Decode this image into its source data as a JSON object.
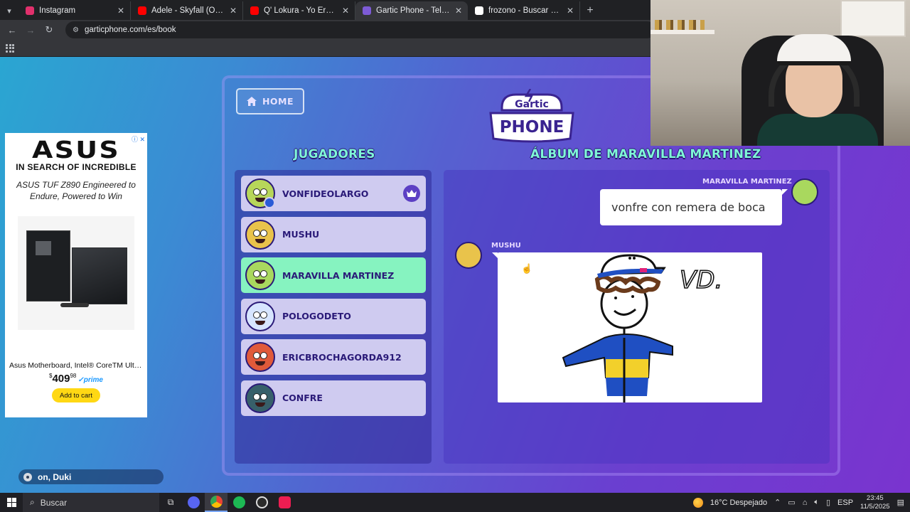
{
  "browser": {
    "tabs": [
      {
        "title": "Instagram",
        "favicon_color": "#e1306c",
        "active": false
      },
      {
        "title": "Adele - Skyfall (Official Lyric Vid",
        "favicon_color": "#ff0000",
        "active": false
      },
      {
        "title": "Q' Lokura - Yo Era (Video Clip C",
        "favicon_color": "#ff0000",
        "active": false
      },
      {
        "title": "Gartic Phone - Teléfono Descon",
        "favicon_color": "#7d5bd6",
        "active": true
      },
      {
        "title": "frozono - Buscar con Google",
        "favicon_color": "#ffffff",
        "active": false
      }
    ],
    "url": "garticphone.com/es/book"
  },
  "ad": {
    "brand": "ASUS",
    "tagline": "IN SEARCH OF INCREDIBLE",
    "copy": "ASUS TUF Z890 Engineered to Endure, Powered to Win",
    "product_name": "Asus Motherboard, Intel® CoreTM Ultra...",
    "price_symbol": "$",
    "price_whole": "409",
    "price_cents": "98",
    "prime": "✓prime",
    "cta": "Add to cart"
  },
  "music": {
    "now_playing": "on, Duki"
  },
  "game": {
    "home_label": "HOME",
    "logo_top": "Gartic",
    "logo_bottom": "PHONE",
    "players_title": "JUGADORES",
    "album_title": "ÁLBUM DE MARAVILLA MARTINEZ",
    "players": [
      {
        "name": "VONFIDEOLARGO",
        "color": "#b7d65a",
        "host": true,
        "active": false
      },
      {
        "name": "MUSHU",
        "color": "#e9c34b",
        "host": false,
        "active": false
      },
      {
        "name": "MARAVILLA MARTINEZ",
        "color": "#a9d85e",
        "host": false,
        "active": true
      },
      {
        "name": "POLOGODETO",
        "color": "#d7e5ff",
        "host": false,
        "active": false
      },
      {
        "name": "ERICBROCHAGORDA912",
        "color": "#e05a3a",
        "host": false,
        "active": false
      },
      {
        "name": "CONFRE",
        "color": "#37606a",
        "host": false,
        "active": false
      }
    ],
    "album": {
      "first_author": "MARAVILLA MARTINEZ",
      "first_text": "vonfre con remera de boca",
      "second_author": "MUSHU",
      "drawing_text": "VD."
    },
    "colors": {
      "accent_mint": "#7ff7d7",
      "active_row": "#86f3c0",
      "row": "#cfcbf0"
    }
  },
  "taskbar": {
    "search_placeholder": "Buscar",
    "weather": "16°C  Despejado",
    "language": "ESP",
    "time": "23:45",
    "date": "11/5/2025"
  }
}
